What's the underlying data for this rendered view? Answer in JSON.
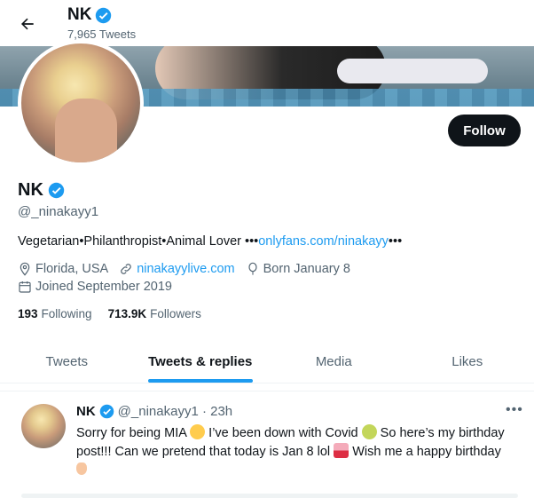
{
  "header": {
    "title": "NK",
    "tweet_count": "7,965 Tweets"
  },
  "profile": {
    "name": "NK",
    "handle": "@_ninakayy1",
    "follow_label": "Follow",
    "bio_text": "Vegetarian•Philanthropist•Animal Lover •••",
    "bio_link": "onlyfans.com/ninakayy",
    "bio_suffix": "•••",
    "location": "Florida, USA",
    "website": "ninakayylive.com",
    "birthday": "Born January 8",
    "joined": "Joined September 2019",
    "following_count": "193",
    "following_label": "Following",
    "followers_count": "713.9K",
    "followers_label": "Followers"
  },
  "tabs": [
    {
      "label": "Tweets"
    },
    {
      "label": "Tweets & replies"
    },
    {
      "label": "Media"
    },
    {
      "label": "Likes"
    }
  ],
  "tweet": {
    "name": "NK",
    "meta": "@_ninakayy1 · 23h",
    "text_1": "Sorry for being MIA ",
    "text_2": " I’ve been down with Covid ",
    "text_3": " So here’s my birthday post!!! Can we pretend that today is Jan 8 lol ",
    "text_4": " Wish me a happy birthday",
    "more": "•••"
  },
  "colors": {
    "accent": "#1d9bf0",
    "text": "#0f1419",
    "secondary": "#536471"
  }
}
